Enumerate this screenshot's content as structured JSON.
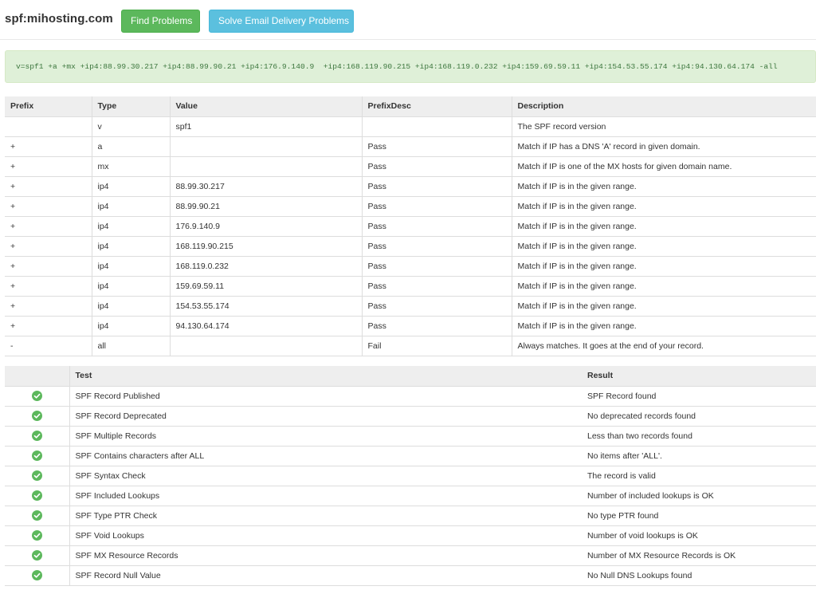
{
  "header": {
    "domain": "spf:mihosting.com",
    "find_button": "Find Problems",
    "solve_button": "Solve Email Delivery Problems"
  },
  "record": "v=spf1 +a +mx +ip4:88.99.30.217 +ip4:88.99.90.21 +ip4:176.9.140.9  +ip4:168.119.90.215 +ip4:168.119.0.232 +ip4:159.69.59.11 +ip4:154.53.55.174 +ip4:94.130.64.174 -all",
  "terms_table": {
    "columns": [
      "Prefix",
      "Type",
      "Value",
      "PrefixDesc",
      "Description"
    ],
    "rows": [
      [
        "",
        "v",
        "spf1",
        "",
        "The SPF record version"
      ],
      [
        "+",
        "a",
        "",
        "Pass",
        "Match if IP has a DNS 'A' record in given domain."
      ],
      [
        "+",
        "mx",
        "",
        "Pass",
        "Match if IP is one of the MX hosts for given domain name."
      ],
      [
        "+",
        "ip4",
        "88.99.30.217",
        "Pass",
        "Match if IP is in the given range."
      ],
      [
        "+",
        "ip4",
        "88.99.90.21",
        "Pass",
        "Match if IP is in the given range."
      ],
      [
        "+",
        "ip4",
        "176.9.140.9",
        "Pass",
        "Match if IP is in the given range."
      ],
      [
        "+",
        "ip4",
        "168.119.90.215",
        "Pass",
        "Match if IP is in the given range."
      ],
      [
        "+",
        "ip4",
        "168.119.0.232",
        "Pass",
        "Match if IP is in the given range."
      ],
      [
        "+",
        "ip4",
        "159.69.59.11",
        "Pass",
        "Match if IP is in the given range."
      ],
      [
        "+",
        "ip4",
        "154.53.55.174",
        "Pass",
        "Match if IP is in the given range."
      ],
      [
        "+",
        "ip4",
        "94.130.64.174",
        "Pass",
        "Match if IP is in the given range."
      ],
      [
        "-",
        "all",
        "",
        "Fail",
        "Always matches. It goes at the end of your record."
      ]
    ]
  },
  "tests_table": {
    "columns": [
      "",
      "Test",
      "Result"
    ],
    "rows": [
      {
        "status_icon": "check-circle-icon",
        "test": "SPF Record Published",
        "result": "SPF Record found"
      },
      {
        "status_icon": "check-circle-icon",
        "test": "SPF Record Deprecated",
        "result": "No deprecated records found"
      },
      {
        "status_icon": "check-circle-icon",
        "test": "SPF Multiple Records",
        "result": "Less than two records found"
      },
      {
        "status_icon": "check-circle-icon",
        "test": "SPF Contains characters after ALL",
        "result": "No items after 'ALL'."
      },
      {
        "status_icon": "check-circle-icon",
        "test": "SPF Syntax Check",
        "result": "The record is valid"
      },
      {
        "status_icon": "check-circle-icon",
        "test": "SPF Included Lookups",
        "result": "Number of included lookups is OK"
      },
      {
        "status_icon": "check-circle-icon",
        "test": "SPF Type PTR Check",
        "result": "No type PTR found"
      },
      {
        "status_icon": "check-circle-icon",
        "test": "SPF Void Lookups",
        "result": "Number of void lookups is OK"
      },
      {
        "status_icon": "check-circle-icon",
        "test": "SPF MX Resource Records",
        "result": "Number of MX Resource Records is OK"
      },
      {
        "status_icon": "check-circle-icon",
        "test": "SPF Record Null Value",
        "result": "No Null DNS Lookups found"
      }
    ]
  },
  "colors": {
    "pass_icon": "#5cb85c",
    "find_button": "#5cb85c",
    "solve_button": "#5bc0de",
    "record_background": "#dff0d8",
    "record_text": "#3c763d"
  }
}
